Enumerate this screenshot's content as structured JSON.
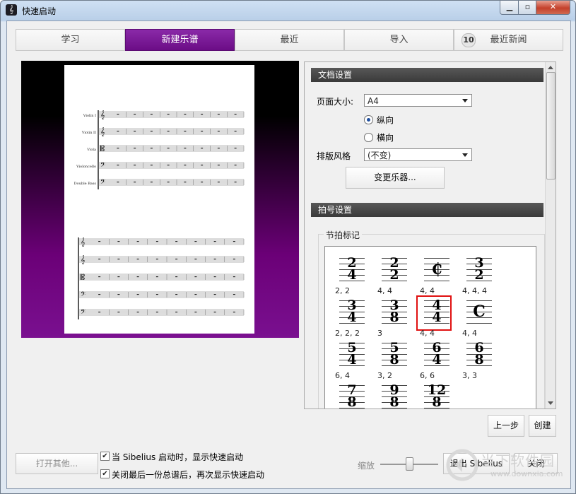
{
  "window": {
    "title": "快速启动",
    "app_icon_glyph": "𝄞",
    "min_glyph": "▁",
    "max_glyph": "▫",
    "close_glyph": "✕"
  },
  "tabs": [
    {
      "label": "学习"
    },
    {
      "label": "新建乐谱"
    },
    {
      "label": "最近"
    },
    {
      "label": "导入"
    },
    {
      "label": "最近新闻",
      "badge": "10"
    }
  ],
  "score_preview": {
    "instruments": [
      "Violin I",
      "Violin II",
      "Viola",
      "Violoncello",
      "Double Bass"
    ]
  },
  "doc_settings": {
    "header": "文档设置",
    "page_size_label": "页面大小:",
    "page_size_value": "A4",
    "orientation_portrait": "纵向",
    "orientation_landscape": "横向",
    "layout_style_label": "排版风格",
    "layout_style_value": "(不变)",
    "change_instruments_button": "变更乐器..."
  },
  "time_sig": {
    "header": "拍号设置",
    "group_label": "节拍标记",
    "items": [
      {
        "top": "2",
        "bottom": "4",
        "caption": "2, 2"
      },
      {
        "top": "2",
        "bottom": "2",
        "caption": "4, 4"
      },
      {
        "top": "₵",
        "bottom": "",
        "caption": "4, 4"
      },
      {
        "top": "3",
        "bottom": "2",
        "caption": "4, 4, 4"
      },
      {
        "top": "3",
        "bottom": "4",
        "caption": "2, 2, 2"
      },
      {
        "top": "3",
        "bottom": "8",
        "caption": "3"
      },
      {
        "top": "4",
        "bottom": "4",
        "caption": "4, 4",
        "selected": true
      },
      {
        "top": "C",
        "bottom": "",
        "caption": "4, 4"
      },
      {
        "top": "5",
        "bottom": "4",
        "caption": "6, 4"
      },
      {
        "top": "5",
        "bottom": "8",
        "caption": "3, 2"
      },
      {
        "top": "6",
        "bottom": "4",
        "caption": "6, 6"
      },
      {
        "top": "6",
        "bottom": "8",
        "caption": "3, 3"
      },
      {
        "top": "7",
        "bottom": "8",
        "caption": ""
      },
      {
        "top": "9",
        "bottom": "8",
        "caption": ""
      },
      {
        "top": "12",
        "bottom": "8",
        "caption": ""
      }
    ]
  },
  "buttons": {
    "prev": "上一步",
    "create": "创建",
    "open_other": "打开其他...",
    "quit": "退出 Sibelius",
    "close": "关闭"
  },
  "options": {
    "show_on_startup": "当 Sibelius 启动时，显示快速启动",
    "show_after_close": "关闭最后一份总谱后，再次显示快速启动",
    "zoom_label": "缩放"
  },
  "watermark": {
    "text": "当下软件园",
    "url": "www.downxia.com"
  }
}
